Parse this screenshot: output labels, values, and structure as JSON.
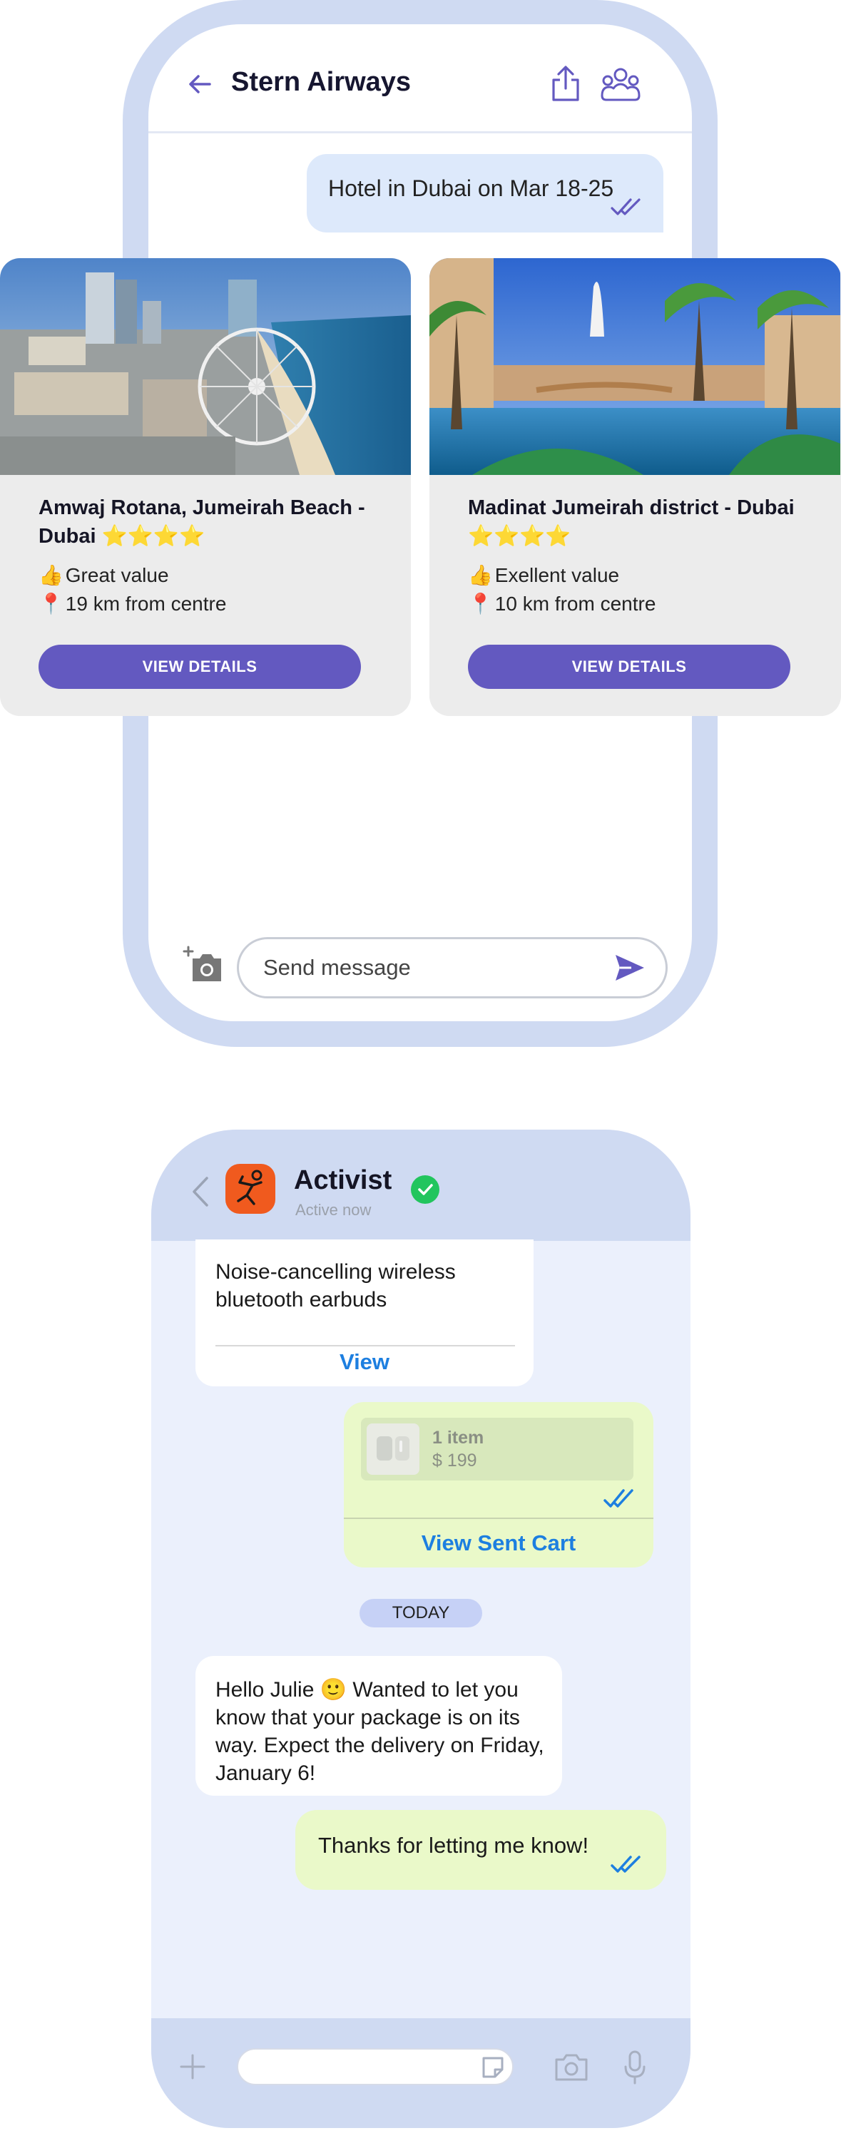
{
  "chat1": {
    "title": "Stern Airways",
    "sent_message": "Hotel in Dubai on Mar 18-25",
    "input_placeholder": "Send message",
    "accent": "#6359c0",
    "hotels": [
      {
        "name": "Amwaj Rotana, Jumeirah Beach - Dubai",
        "stars": "⭐⭐⭐⭐",
        "value_emoji": "👍",
        "value": "Great value",
        "distance_emoji": "📍",
        "distance": "19 km from centre",
        "button": "VIEW DETAILS"
      },
      {
        "name": "Madinat Jumeirah district - Dubai",
        "stars": "⭐⭐⭐⭐",
        "value_emoji": "👍",
        "value": "Exellent value",
        "distance_emoji": "📍",
        "distance": "10 km from centre",
        "button": "VIEW DETAILS"
      }
    ]
  },
  "chat2": {
    "title": "Activist",
    "status": "Active now",
    "product_text": "Noise-cancelling wireless bluetooth earbuds",
    "product_link": "View",
    "cart_items": "1 item",
    "cart_price": "$ 199",
    "cart_link": "View Sent Cart",
    "date_chip": "TODAY",
    "incoming_message": "Hello Julie 🙂 Wanted to let you know that your package is on its way. Expect the delivery on Friday, January 6!",
    "outgoing_message": "Thanks for letting me know!",
    "link_color": "#1d7fe0",
    "verified_color": "#22c55e"
  }
}
